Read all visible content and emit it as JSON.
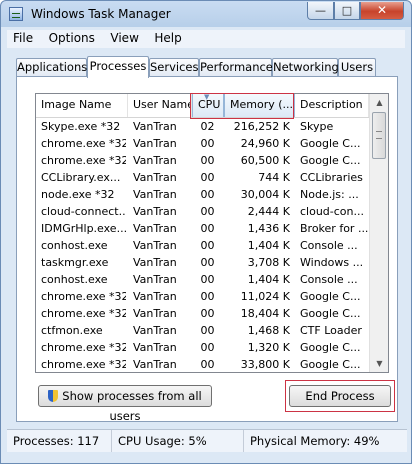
{
  "window": {
    "title": "Windows Task Manager",
    "minimize": "—",
    "maximize": "□",
    "close": "✕"
  },
  "menu": [
    "File",
    "Options",
    "View",
    "Help"
  ],
  "tabs": [
    "Applications",
    "Processes",
    "Services",
    "Performance",
    "Networking",
    "Users"
  ],
  "active_tab": "Processes",
  "columns": [
    "Image Name",
    "User Name",
    "CPU",
    "Memory (...",
    "Description"
  ],
  "sorted_column": "CPU",
  "highlight_color": "#cc3344",
  "processes": [
    {
      "name": "Skype.exe *32",
      "user": "VanTran",
      "cpu": "02",
      "memory": "216,252 K",
      "desc": "Skype"
    },
    {
      "name": "chrome.exe *32",
      "user": "VanTran",
      "cpu": "00",
      "memory": "24,960 K",
      "desc": "Google C..."
    },
    {
      "name": "chrome.exe *32",
      "user": "VanTran",
      "cpu": "00",
      "memory": "60,500 K",
      "desc": "Google C..."
    },
    {
      "name": "CCLibrary.ex...",
      "user": "VanTran",
      "cpu": "00",
      "memory": "744 K",
      "desc": "CCLibraries"
    },
    {
      "name": "node.exe *32",
      "user": "VanTran",
      "cpu": "00",
      "memory": "30,004 K",
      "desc": "Node.js: ..."
    },
    {
      "name": "cloud-connect...",
      "user": "VanTran",
      "cpu": "00",
      "memory": "2,444 K",
      "desc": "cloud-con..."
    },
    {
      "name": "IDMGrHlp.exe...",
      "user": "VanTran",
      "cpu": "00",
      "memory": "1,436 K",
      "desc": "Broker for ..."
    },
    {
      "name": "conhost.exe",
      "user": "VanTran",
      "cpu": "00",
      "memory": "1,404 K",
      "desc": "Console ..."
    },
    {
      "name": "taskmgr.exe",
      "user": "VanTran",
      "cpu": "00",
      "memory": "3,708 K",
      "desc": "Windows ..."
    },
    {
      "name": "conhost.exe",
      "user": "VanTran",
      "cpu": "00",
      "memory": "1,404 K",
      "desc": "Console ..."
    },
    {
      "name": "chrome.exe *32",
      "user": "VanTran",
      "cpu": "00",
      "memory": "11,024 K",
      "desc": "Google C..."
    },
    {
      "name": "chrome.exe *32",
      "user": "VanTran",
      "cpu": "00",
      "memory": "18,404 K",
      "desc": "Google C..."
    },
    {
      "name": "ctfmon.exe",
      "user": "VanTran",
      "cpu": "00",
      "memory": "1,468 K",
      "desc": "CTF Loader"
    },
    {
      "name": "chrome.exe *32",
      "user": "VanTran",
      "cpu": "00",
      "memory": "1,320 K",
      "desc": "Google C..."
    },
    {
      "name": "chrome.exe *32",
      "user": "VanTran",
      "cpu": "00",
      "memory": "33,800 K",
      "desc": "Google C..."
    }
  ],
  "buttons": {
    "show_all": "Show processes from all users",
    "end_process": "End Process"
  },
  "status": {
    "processes": "Processes: 117",
    "cpu": "CPU Usage: 5%",
    "memory": "Physical Memory: 49%"
  }
}
